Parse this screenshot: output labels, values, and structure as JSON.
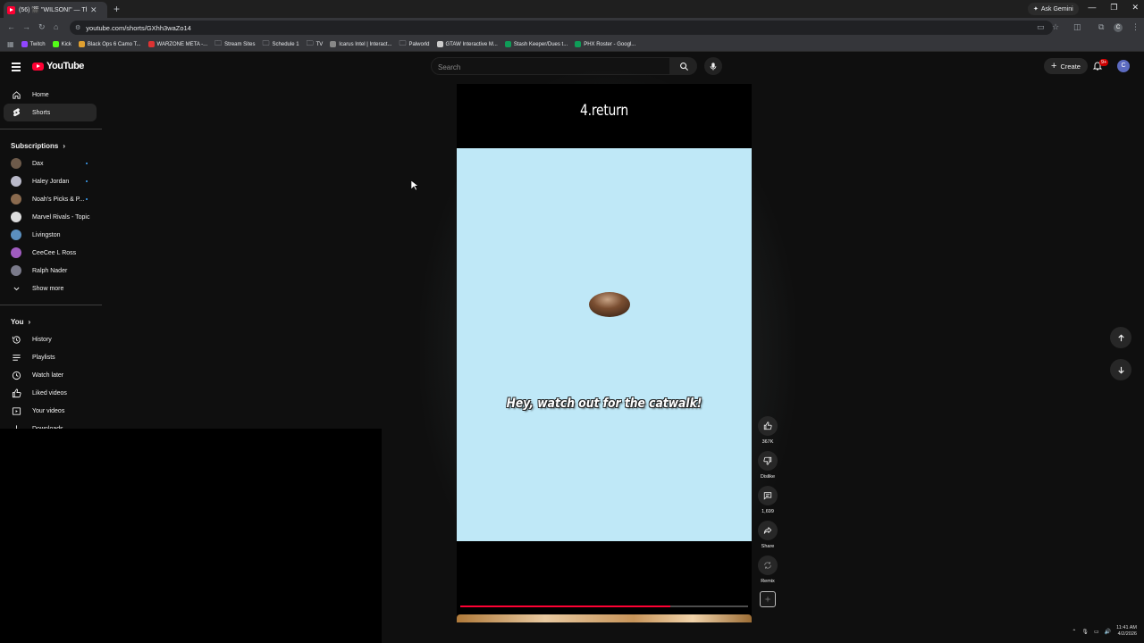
{
  "browser": {
    "tab_title": "(56) 🎬 \"WILSON!\" — The",
    "new_tab": "+",
    "ask_gemini": "Ask Gemini",
    "url": "youtube.com/shorts/GXhh3waZo14",
    "bookmarks": [
      {
        "label": "Twitch",
        "color": "#9146ff"
      },
      {
        "label": "Kick",
        "color": "#53fc18"
      },
      {
        "label": "Black Ops 6 Camo T...",
        "color": "#e0a030"
      },
      {
        "label": "WARZONE META -...",
        "color": "#d33"
      },
      {
        "label": "Stream Sites",
        "color": "folder"
      },
      {
        "label": "Schedule 1",
        "color": "folder"
      },
      {
        "label": "TV",
        "color": "folder"
      },
      {
        "label": "Icarus Intel | Interact...",
        "color": "#888"
      },
      {
        "label": "Palworld",
        "color": "folder"
      },
      {
        "label": "GTAW Interactive M...",
        "color": "#ccc"
      },
      {
        "label": "Stash Keeper/Dues t...",
        "color": "#0f9d58"
      },
      {
        "label": "PHX Roster - Googl...",
        "color": "#0f9d58"
      }
    ]
  },
  "youtube": {
    "logo": "YouTube",
    "search_placeholder": "Search",
    "create_label": "Create",
    "notification_badge": "9+",
    "avatar_letter": "C"
  },
  "sidebar": {
    "main": [
      {
        "label": "Home",
        "icon": "home-icon"
      },
      {
        "label": "Shorts",
        "icon": "shorts-icon",
        "active": true
      }
    ],
    "subscriptions_title": "Subscriptions",
    "subscriptions": [
      {
        "label": "Dax",
        "color": "#6d5a4a",
        "dot": true
      },
      {
        "label": "Haley Jordan",
        "color": "#b9b9c9",
        "dot": true
      },
      {
        "label": "Noah's Picks & P...",
        "color": "#8a6a4e",
        "dot": true
      },
      {
        "label": "Marvel Rivals - Topic",
        "color": "#dddddd",
        "dot": false
      },
      {
        "label": "Livingston",
        "color": "#5b8fbf",
        "dot": false
      },
      {
        "label": "CeeCee L Ross",
        "color": "#a05cc0",
        "dot": false
      },
      {
        "label": "Ralph Nader",
        "color": "#7a7a8a",
        "dot": false
      }
    ],
    "show_more": "Show more",
    "you_title": "You",
    "you": [
      {
        "label": "History",
        "icon": "history-icon"
      },
      {
        "label": "Playlists",
        "icon": "playlists-icon"
      },
      {
        "label": "Watch later",
        "icon": "watch-later-icon"
      },
      {
        "label": "Liked videos",
        "icon": "liked-icon"
      },
      {
        "label": "Your videos",
        "icon": "your-videos-icon"
      },
      {
        "label": "Downloads",
        "icon": "download-icon"
      }
    ]
  },
  "short": {
    "heading": "4.return",
    "caption": "Hey, watch out for the catwalk!",
    "progress": 0.73,
    "likes": "367K",
    "dislike_label": "Dislike",
    "comments": "1,699",
    "share_label": "Share",
    "remix_label": "Remix"
  },
  "tray": {
    "time": "11:41 AM",
    "date": "4/2/2026"
  }
}
